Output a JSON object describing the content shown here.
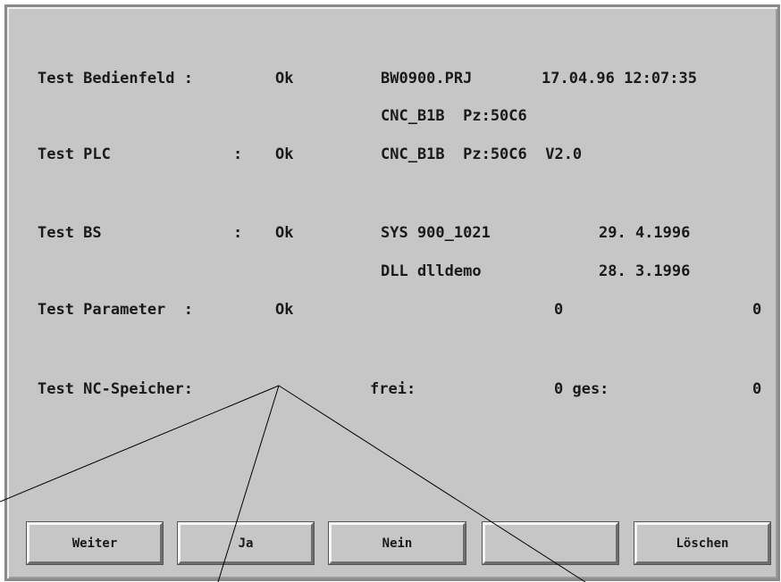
{
  "tests": {
    "bedienfeld": {
      "label": "Test Bedienfeld :",
      "status": "Ok"
    },
    "plc": {
      "label": "Test PLC",
      "colon": ":",
      "status": "Ok"
    },
    "bs": {
      "label": "Test BS",
      "colon": ":",
      "status": "Ok"
    },
    "parameter": {
      "label": "Test Parameter  :",
      "status": "Ok"
    },
    "nc_speicher": {
      "label": "Test NC-Speicher:"
    }
  },
  "info": {
    "project": "BW0900.PRJ",
    "datetime": "17.04.96 12:07:35",
    "cnc1": "CNC_B1B  Pz:50C6",
    "cnc2": "CNC_B1B  Pz:50C6  V2.0",
    "sys_name": "SYS 900_1021",
    "sys_date": "29. 4.1996",
    "dll_name": "DLL dlldemo",
    "dll_date": "28. 3.1996",
    "param_val1": "0",
    "param_val2": "0",
    "frei_label": "frei:",
    "frei_value": "0 ges:",
    "ges_value": "0"
  },
  "buttons": {
    "weiter": "Weiter",
    "ja": "Ja",
    "nein": "Nein",
    "empty": "",
    "loeschen": "Löschen"
  }
}
